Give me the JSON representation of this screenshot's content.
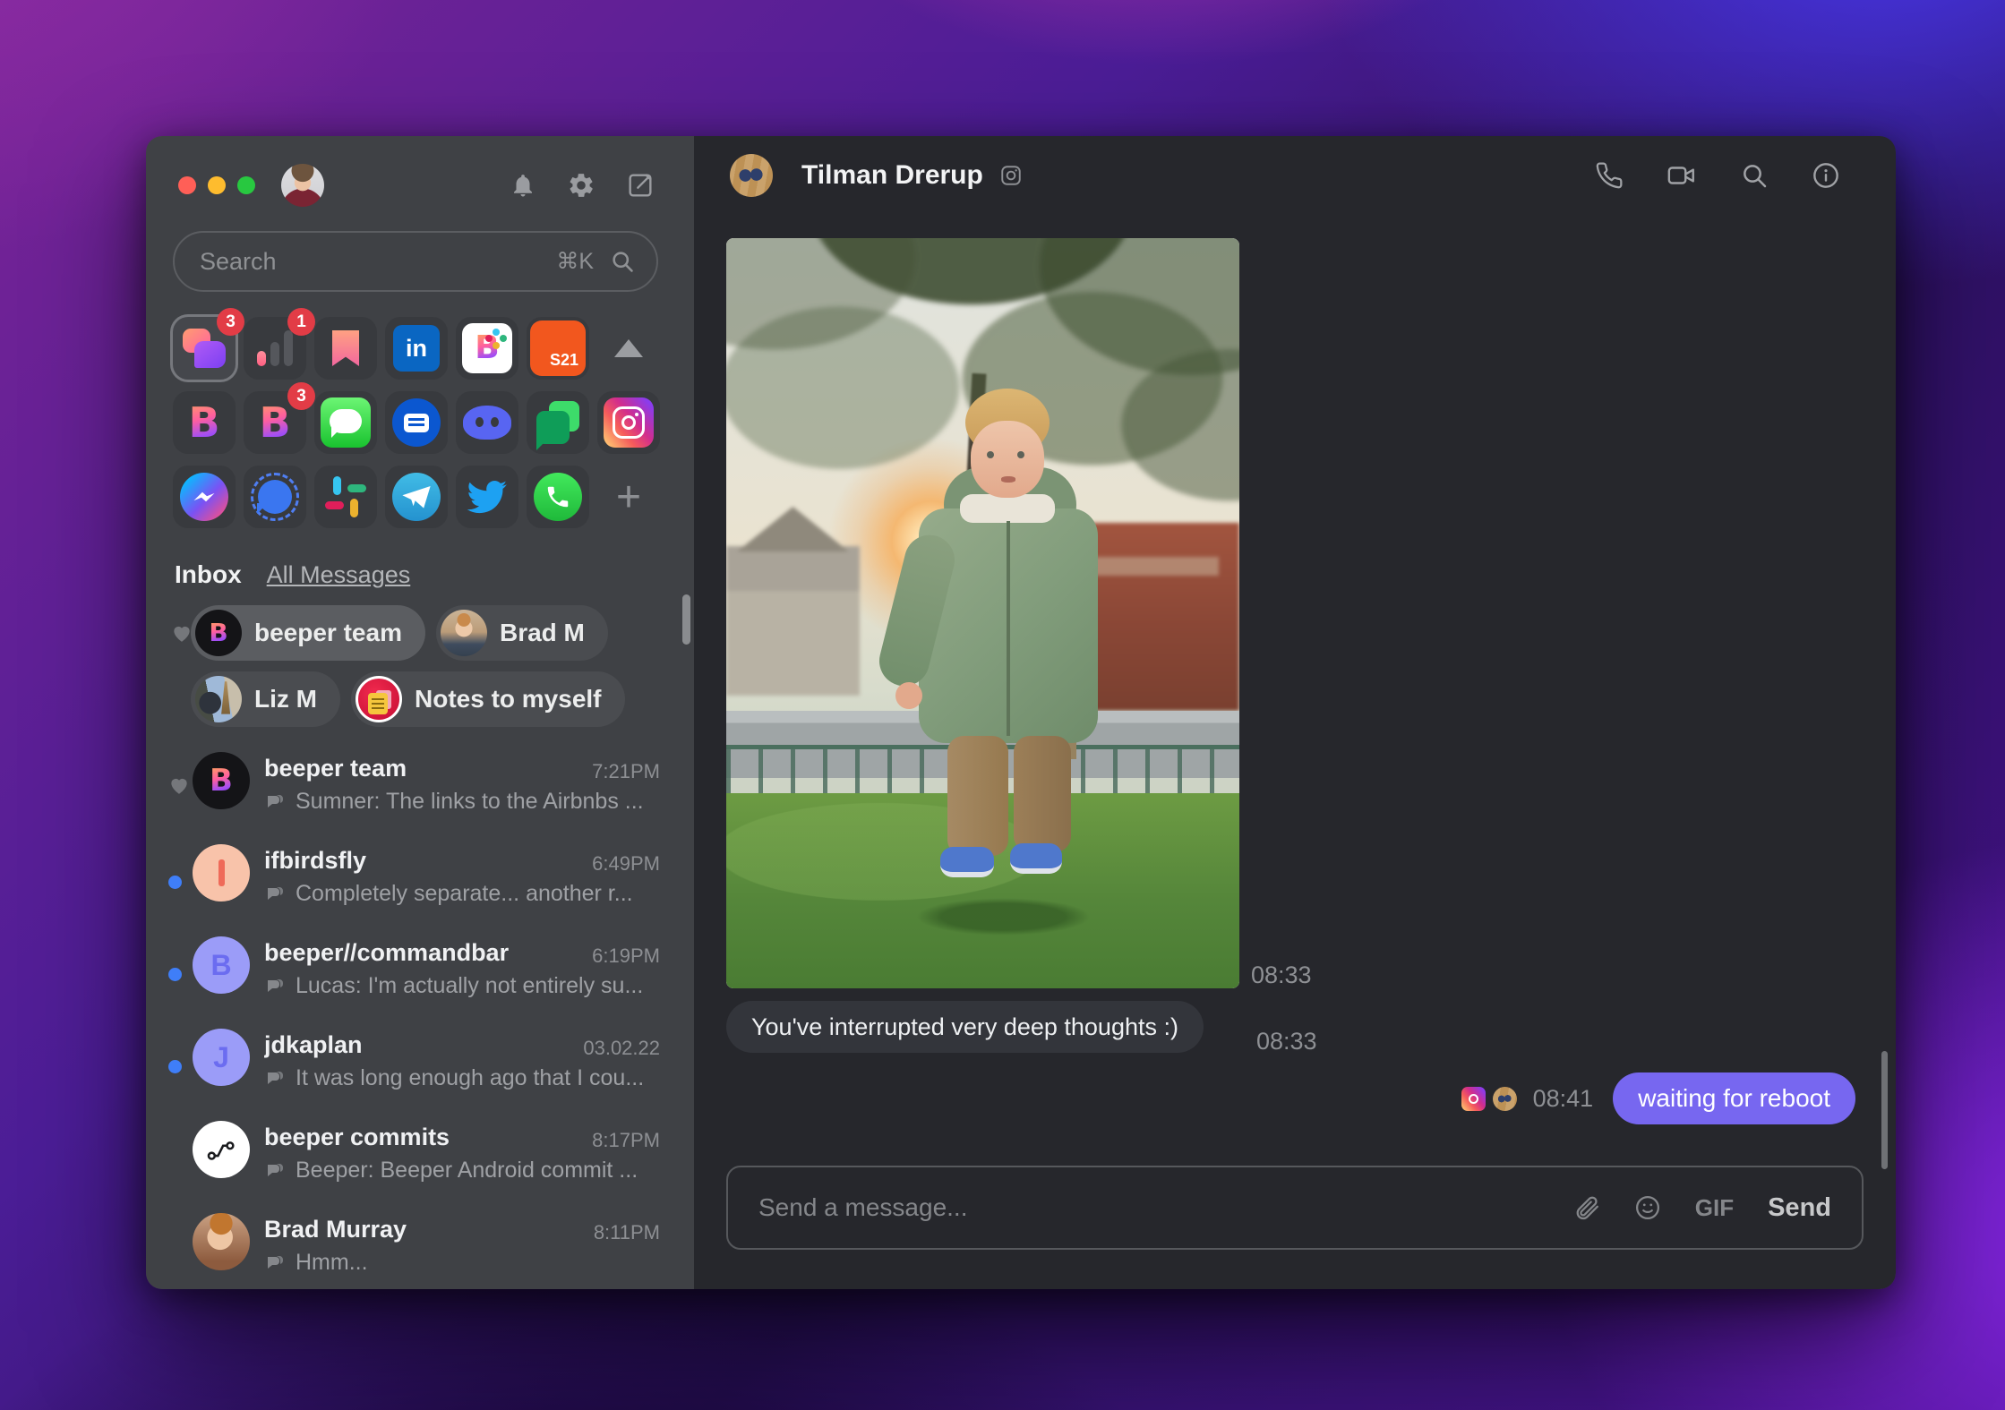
{
  "sidebar": {
    "search": {
      "placeholder": "Search",
      "shortcut": "⌘K"
    },
    "badges": {
      "all_chats": "3",
      "stats": "1",
      "beeper": "3"
    },
    "glyphs": {
      "beeper_letter": "B",
      "linkedin": "in",
      "s21": "S21",
      "plus": "+"
    },
    "inbox": {
      "title": "Inbox",
      "filter": "All Messages"
    },
    "favorites": [
      {
        "label": "beeper team"
      },
      {
        "label": "Brad M"
      },
      {
        "label": "Liz M"
      },
      {
        "label": "Notes to myself"
      }
    ],
    "chats": [
      {
        "name": "beeper team",
        "time": "7:21PM",
        "preview": "Sumner: The links to the Airbnbs ..."
      },
      {
        "name": "ifbirdsfly",
        "time": "6:49PM",
        "preview": "Completely separate... another r...",
        "initial": "I"
      },
      {
        "name": "beeper//commandbar",
        "time": "6:19PM",
        "preview": "Lucas: I'm actually not entirely su...",
        "initial": "B"
      },
      {
        "name": "jdkaplan",
        "time": "03.02.22",
        "preview": "It was long enough ago that I cou...",
        "initial": "J"
      },
      {
        "name": "beeper commits",
        "time": "8:17PM",
        "preview": "Beeper: Beeper Android commit ..."
      },
      {
        "name": "Brad Murray",
        "time": "8:11PM",
        "preview": "Hmm..."
      }
    ],
    "icon_names": [
      "bell-icon",
      "gear-icon",
      "compose-icon",
      "search-icon",
      "collapse-icon",
      "add-network-icon",
      "heart-icon",
      "chat-preview-icon"
    ]
  },
  "chat": {
    "title": "Tilman Drerup",
    "network": "instagram",
    "photo_time": "08:33",
    "incoming": {
      "text": "You've interrupted very deep thoughts :)",
      "time": "08:33"
    },
    "outgoing": {
      "text": "waiting for reboot",
      "time": "08:41"
    },
    "composer": {
      "placeholder": "Send a message...",
      "gif": "GIF",
      "send": "Send"
    },
    "header_icon_names": [
      "phone-icon",
      "video-icon",
      "search-icon",
      "info-icon",
      "instagram-icon"
    ]
  },
  "colors": {
    "accent_bubble": "#7767f0",
    "unread_dot": "#3f7ef8",
    "badge": "#e23c46",
    "sidebar_bg": "#3f4145",
    "chat_bg": "#26272c"
  }
}
